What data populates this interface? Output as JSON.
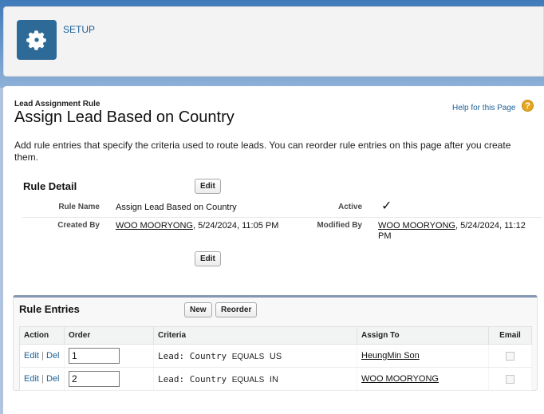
{
  "header": {
    "setup_label": "SETUP",
    "icon": "gear-icon"
  },
  "page": {
    "eyebrow": "Lead Assignment Rule",
    "title": "Assign Lead Based on Country",
    "help_link": "Help for this Page",
    "description": "Add rule entries that specify the criteria used to route leads. You can reorder rule entries on this page after you create them."
  },
  "rule_detail": {
    "title": "Rule Detail",
    "edit_label": "Edit",
    "rule_name_label": "Rule Name",
    "rule_name_value": "Assign Lead Based on Country",
    "active_label": "Active",
    "active_value": "✓",
    "created_by_label": "Created By",
    "created_by_user": "WOO MOORYONG",
    "created_by_date": ", 5/24/2024, 11:05 PM",
    "modified_by_label": "Modified By",
    "modified_by_user": "WOO MOORYONG",
    "modified_by_date": ", 5/24/2024, 11:12 PM"
  },
  "rule_entries": {
    "title": "Rule Entries",
    "new_label": "New",
    "reorder_label": "Reorder",
    "columns": [
      "Action",
      "Order",
      "Criteria",
      "Assign To",
      "Email"
    ],
    "rows": [
      {
        "edit": "Edit",
        "sep": "|",
        "del": "Del",
        "order": "1",
        "crit_field": "Lead: Country",
        "crit_op": "EQUALS",
        "crit_value": "US",
        "assign_to": "HeungMin Son"
      },
      {
        "edit": "Edit",
        "sep": "|",
        "del": "Del",
        "order": "2",
        "crit_field": "Lead: Country",
        "crit_op": "EQUALS",
        "crit_value": "IN",
        "assign_to": "WOO MOORYONG"
      }
    ]
  },
  "colors": {
    "accent": "#2e6a98",
    "link": "#1d5f97",
    "help": "#e5a623"
  }
}
